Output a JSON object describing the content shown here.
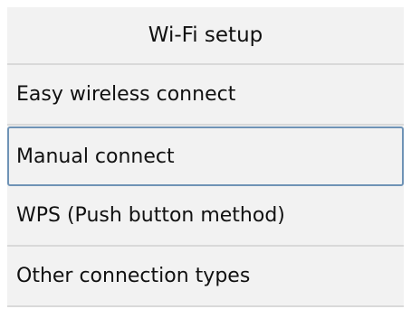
{
  "header": {
    "title": "Wi-Fi setup"
  },
  "menu": {
    "items": [
      {
        "label": "Easy wireless connect",
        "selected": false
      },
      {
        "label": "Manual connect",
        "selected": true
      },
      {
        "label": "WPS (Push button method)",
        "selected": false
      },
      {
        "label": "Other connection types",
        "selected": false
      }
    ]
  }
}
